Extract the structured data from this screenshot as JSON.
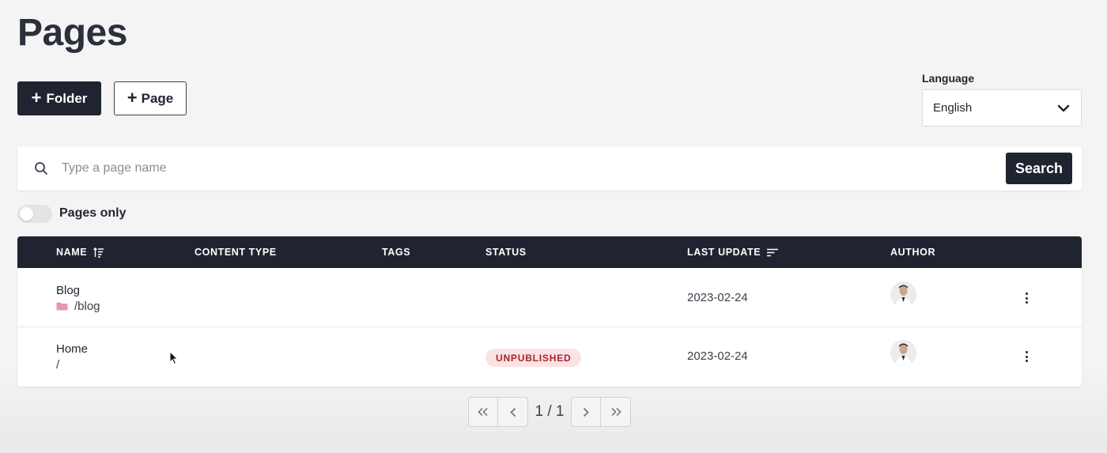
{
  "page": {
    "title": "Pages"
  },
  "actions": {
    "folder_label": "Folder",
    "page_label": "Page"
  },
  "language": {
    "label": "Language",
    "selected": "English"
  },
  "search": {
    "placeholder": "Type a page name",
    "button_label": "Search"
  },
  "filter": {
    "pages_only_label": "Pages only",
    "pages_only_on": false
  },
  "table": {
    "columns": [
      "NAME",
      "CONTENT TYPE",
      "TAGS",
      "STATUS",
      "LAST UPDATE",
      "AUTHOR"
    ],
    "rows": [
      {
        "name": "Blog",
        "path": "/blog",
        "is_folder": true,
        "content_type": "",
        "tags": "",
        "status": "",
        "last_update": "2023-02-24"
      },
      {
        "name": "Home",
        "path": "/",
        "is_folder": false,
        "content_type": "",
        "tags": "",
        "status": "UNPUBLISHED",
        "last_update": "2023-02-24"
      }
    ]
  },
  "pagination": {
    "current": "1 / 1"
  },
  "colors": {
    "primary": "#1f2430",
    "badge_bg": "#fbe3e4",
    "badge_text": "#a3262c",
    "folder": "#e596b0"
  },
  "icons": [
    "plus-icon",
    "chevron-down-icon",
    "search-icon",
    "sort-icon",
    "folder-icon",
    "more-vertical-icon",
    "double-chevron-left-icon",
    "chevron-left-icon",
    "chevron-right-icon",
    "double-chevron-right-icon",
    "mouse-cursor-icon"
  ]
}
